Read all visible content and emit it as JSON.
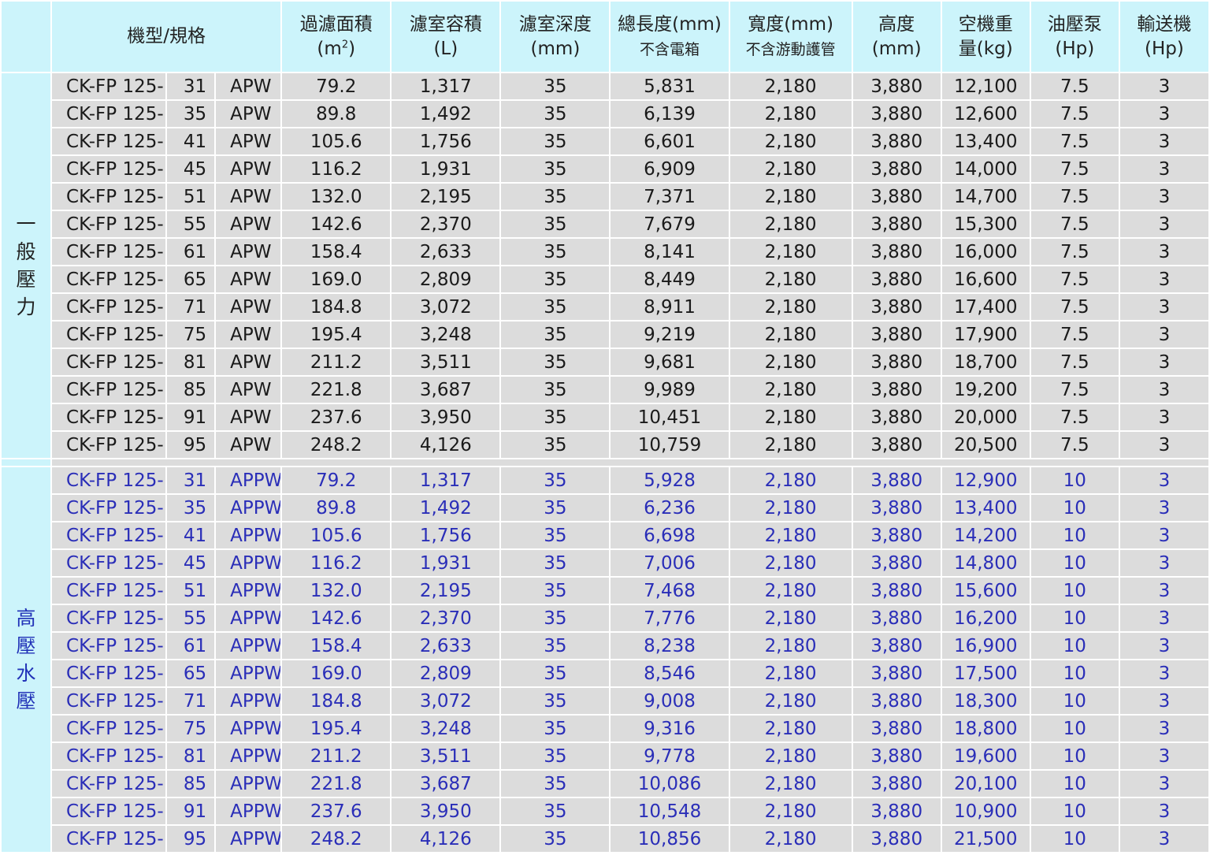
{
  "headers": {
    "model_spec": "機型/規格",
    "filter_area": "過濾面積",
    "filter_area_unit_pre": "(m",
    "filter_area_unit_sup": "2",
    "filter_area_unit_post": ")",
    "chamber_volume": "濾室容積",
    "chamber_volume_unit": "(L)",
    "chamber_depth": "濾室深度",
    "chamber_depth_unit": "(mm)",
    "total_length": "總長度(mm)",
    "total_length_note": "不含電箱",
    "width": "寬度(mm)",
    "width_note": "不含游動護管",
    "height": "高度",
    "height_unit": "(mm)",
    "weight_line1": "空機重",
    "weight_line2": "量(kg)",
    "oil_pump": "油壓泵",
    "oil_pump_unit": "(Hp)",
    "conveyor": "輸送機",
    "conveyor_unit": "(Hp)"
  },
  "groups": [
    {
      "label": "一\n般\n壓\n力",
      "rows": [
        {
          "prefix": "CK-FP 125-",
          "num": "31",
          "suffix": "APW",
          "area": "79.2",
          "volume": "1,317",
          "depth": "35",
          "length": "5,831",
          "width": "2,180",
          "height": "3,880",
          "weight": "12,100",
          "pump": "7.5",
          "conveyor": "3"
        },
        {
          "prefix": "CK-FP 125-",
          "num": "35",
          "suffix": "APW",
          "area": "89.8",
          "volume": "1,492",
          "depth": "35",
          "length": "6,139",
          "width": "2,180",
          "height": "3,880",
          "weight": "12,600",
          "pump": "7.5",
          "conveyor": "3"
        },
        {
          "prefix": "CK-FP 125-",
          "num": "41",
          "suffix": "APW",
          "area": "105.6",
          "volume": "1,756",
          "depth": "35",
          "length": "6,601",
          "width": "2,180",
          "height": "3,880",
          "weight": "13,400",
          "pump": "7.5",
          "conveyor": "3"
        },
        {
          "prefix": "CK-FP 125-",
          "num": "45",
          "suffix": "APW",
          "area": "116.2",
          "volume": "1,931",
          "depth": "35",
          "length": "6,909",
          "width": "2,180",
          "height": "3,880",
          "weight": "14,000",
          "pump": "7.5",
          "conveyor": "3"
        },
        {
          "prefix": "CK-FP 125-",
          "num": "51",
          "suffix": "APW",
          "area": "132.0",
          "volume": "2,195",
          "depth": "35",
          "length": "7,371",
          "width": "2,180",
          "height": "3,880",
          "weight": "14,700",
          "pump": "7.5",
          "conveyor": "3"
        },
        {
          "prefix": "CK-FP 125-",
          "num": "55",
          "suffix": "APW",
          "area": "142.6",
          "volume": "2,370",
          "depth": "35",
          "length": "7,679",
          "width": "2,180",
          "height": "3,880",
          "weight": "15,300",
          "pump": "7.5",
          "conveyor": "3"
        },
        {
          "prefix": "CK-FP 125-",
          "num": "61",
          "suffix": "APW",
          "area": "158.4",
          "volume": "2,633",
          "depth": "35",
          "length": "8,141",
          "width": "2,180",
          "height": "3,880",
          "weight": "16,000",
          "pump": "7.5",
          "conveyor": "3"
        },
        {
          "prefix": "CK-FP 125-",
          "num": "65",
          "suffix": "APW",
          "area": "169.0",
          "volume": "2,809",
          "depth": "35",
          "length": "8,449",
          "width": "2,180",
          "height": "3,880",
          "weight": "16,600",
          "pump": "7.5",
          "conveyor": "3"
        },
        {
          "prefix": "CK-FP 125-",
          "num": "71",
          "suffix": "APW",
          "area": "184.8",
          "volume": "3,072",
          "depth": "35",
          "length": "8,911",
          "width": "2,180",
          "height": "3,880",
          "weight": "17,400",
          "pump": "7.5",
          "conveyor": "3"
        },
        {
          "prefix": "CK-FP 125-",
          "num": "75",
          "suffix": "APW",
          "area": "195.4",
          "volume": "3,248",
          "depth": "35",
          "length": "9,219",
          "width": "2,180",
          "height": "3,880",
          "weight": "17,900",
          "pump": "7.5",
          "conveyor": "3"
        },
        {
          "prefix": "CK-FP 125-",
          "num": "81",
          "suffix": "APW",
          "area": "211.2",
          "volume": "3,511",
          "depth": "35",
          "length": "9,681",
          "width": "2,180",
          "height": "3,880",
          "weight": "18,700",
          "pump": "7.5",
          "conveyor": "3"
        },
        {
          "prefix": "CK-FP 125-",
          "num": "85",
          "suffix": "APW",
          "area": "221.8",
          "volume": "3,687",
          "depth": "35",
          "length": "9,989",
          "width": "2,180",
          "height": "3,880",
          "weight": "19,200",
          "pump": "7.5",
          "conveyor": "3"
        },
        {
          "prefix": "CK-FP 125-",
          "num": "91",
          "suffix": "APW",
          "area": "237.6",
          "volume": "3,950",
          "depth": "35",
          "length": "10,451",
          "width": "2,180",
          "height": "3,880",
          "weight": "20,000",
          "pump": "7.5",
          "conveyor": "3"
        },
        {
          "prefix": "CK-FP 125-",
          "num": "95",
          "suffix": "APW",
          "area": "248.2",
          "volume": "4,126",
          "depth": "35",
          "length": "10,759",
          "width": "2,180",
          "height": "3,880",
          "weight": "20,500",
          "pump": "7.5",
          "conveyor": "3"
        }
      ]
    },
    {
      "label": "高\n壓\n水\n壓",
      "rows": [
        {
          "prefix": "CK-FP 125-",
          "num": "31",
          "suffix": "APPW",
          "area": "79.2",
          "volume": "1,317",
          "depth": "35",
          "length": "5,928",
          "width": "2,180",
          "height": "3,880",
          "weight": "12,900",
          "pump": "10",
          "conveyor": "3"
        },
        {
          "prefix": "CK-FP 125-",
          "num": "35",
          "suffix": "APPW",
          "area": "89.8",
          "volume": "1,492",
          "depth": "35",
          "length": "6,236",
          "width": "2,180",
          "height": "3,880",
          "weight": "13,400",
          "pump": "10",
          "conveyor": "3"
        },
        {
          "prefix": "CK-FP 125-",
          "num": "41",
          "suffix": "APPW",
          "area": "105.6",
          "volume": "1,756",
          "depth": "35",
          "length": "6,698",
          "width": "2,180",
          "height": "3,880",
          "weight": "14,200",
          "pump": "10",
          "conveyor": "3"
        },
        {
          "prefix": "CK-FP 125-",
          "num": "45",
          "suffix": "APPW",
          "area": "116.2",
          "volume": "1,931",
          "depth": "35",
          "length": "7,006",
          "width": "2,180",
          "height": "3,880",
          "weight": "14,800",
          "pump": "10",
          "conveyor": "3"
        },
        {
          "prefix": "CK-FP 125-",
          "num": "51",
          "suffix": "APPW",
          "area": "132.0",
          "volume": "2,195",
          "depth": "35",
          "length": "7,468",
          "width": "2,180",
          "height": "3,880",
          "weight": "15,600",
          "pump": "10",
          "conveyor": "3"
        },
        {
          "prefix": "CK-FP 125-",
          "num": "55",
          "suffix": "APPW",
          "area": "142.6",
          "volume": "2,370",
          "depth": "35",
          "length": "7,776",
          "width": "2,180",
          "height": "3,880",
          "weight": "16,200",
          "pump": "10",
          "conveyor": "3"
        },
        {
          "prefix": "CK-FP 125-",
          "num": "61",
          "suffix": "APPW",
          "area": "158.4",
          "volume": "2,633",
          "depth": "35",
          "length": "8,238",
          "width": "2,180",
          "height": "3,880",
          "weight": "16,900",
          "pump": "10",
          "conveyor": "3"
        },
        {
          "prefix": "CK-FP 125-",
          "num": "65",
          "suffix": "APPW",
          "area": "169.0",
          "volume": "2,809",
          "depth": "35",
          "length": "8,546",
          "width": "2,180",
          "height": "3,880",
          "weight": "17,500",
          "pump": "10",
          "conveyor": "3"
        },
        {
          "prefix": "CK-FP 125-",
          "num": "71",
          "suffix": "APPW",
          "area": "184.8",
          "volume": "3,072",
          "depth": "35",
          "length": "9,008",
          "width": "2,180",
          "height": "3,880",
          "weight": "18,300",
          "pump": "10",
          "conveyor": "3"
        },
        {
          "prefix": "CK-FP 125-",
          "num": "75",
          "suffix": "APPW",
          "area": "195.4",
          "volume": "3,248",
          "depth": "35",
          "length": "9,316",
          "width": "2,180",
          "height": "3,880",
          "weight": "18,800",
          "pump": "10",
          "conveyor": "3"
        },
        {
          "prefix": "CK-FP 125-",
          "num": "81",
          "suffix": "APPW",
          "area": "211.2",
          "volume": "3,511",
          "depth": "35",
          "length": "9,778",
          "width": "2,180",
          "height": "3,880",
          "weight": "19,600",
          "pump": "10",
          "conveyor": "3"
        },
        {
          "prefix": "CK-FP 125-",
          "num": "85",
          "suffix": "APPW",
          "area": "221.8",
          "volume": "3,687",
          "depth": "35",
          "length": "10,086",
          "width": "2,180",
          "height": "3,880",
          "weight": "20,100",
          "pump": "10",
          "conveyor": "3"
        },
        {
          "prefix": "CK-FP 125-",
          "num": "91",
          "suffix": "APPW",
          "area": "237.6",
          "volume": "3,950",
          "depth": "35",
          "length": "10,548",
          "width": "2,180",
          "height": "3,880",
          "weight": "10,900",
          "pump": "10",
          "conveyor": "3"
        },
        {
          "prefix": "CK-FP 125-",
          "num": "95",
          "suffix": "APPW",
          "area": "248.2",
          "volume": "4,126",
          "depth": "35",
          "length": "10,856",
          "width": "2,180",
          "height": "3,880",
          "weight": "21,500",
          "pump": "10",
          "conveyor": "3"
        }
      ]
    }
  ]
}
